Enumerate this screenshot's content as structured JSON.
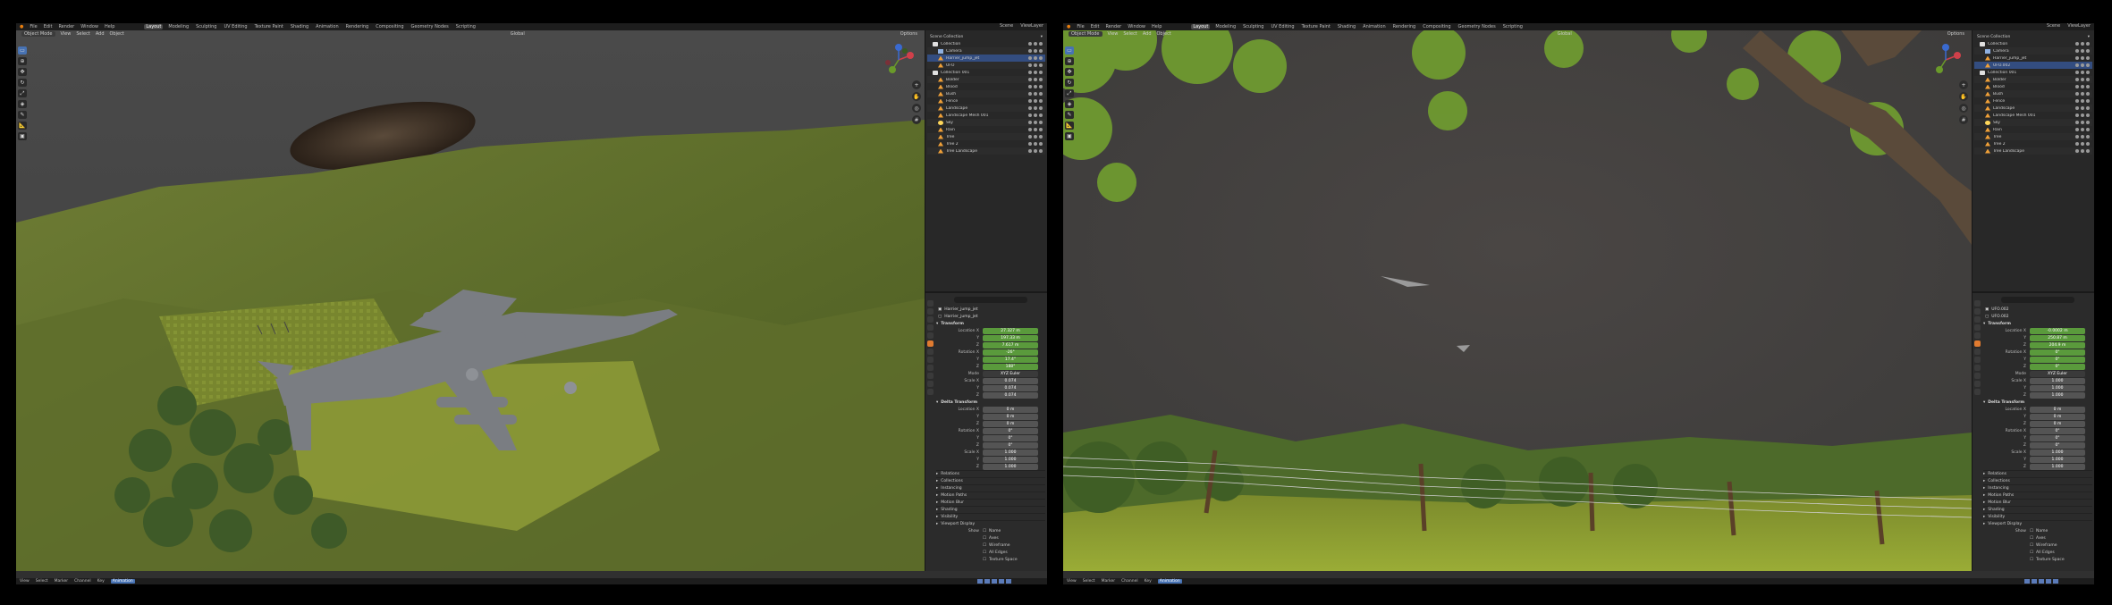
{
  "menu": {
    "items": [
      "File",
      "Edit",
      "Render",
      "Window",
      "Help"
    ],
    "workspaces": [
      "Layout",
      "Modeling",
      "Sculpting",
      "UV Editing",
      "Texture Paint",
      "Shading",
      "Animation",
      "Rendering",
      "Compositing",
      "Geometry Nodes",
      "Scripting"
    ],
    "active_workspace": "Layout",
    "scene_label": "Scene",
    "view_layer_label": "ViewLayer"
  },
  "left": {
    "viewport": {
      "mode": "Object Mode",
      "menus": [
        "View",
        "Select",
        "Add",
        "Object"
      ],
      "transform": "Global",
      "options": "Options"
    },
    "outliner": {
      "title": "Scene Collection",
      "rows": [
        {
          "name": "Collection",
          "kind": "coll",
          "indent": 1
        },
        {
          "name": "Camera",
          "kind": "cam",
          "indent": 2
        },
        {
          "name": "Harrier_jump_jet",
          "kind": "mesh",
          "indent": 2,
          "selected": true
        },
        {
          "name": "UFO",
          "kind": "mesh",
          "indent": 2
        },
        {
          "name": "Collection 001",
          "kind": "coll",
          "indent": 1
        },
        {
          "name": "Bolder",
          "kind": "mesh",
          "indent": 2
        },
        {
          "name": "Blood",
          "kind": "mesh",
          "indent": 2
        },
        {
          "name": "Bush",
          "kind": "mesh",
          "indent": 2
        },
        {
          "name": "Fence",
          "kind": "mesh",
          "indent": 2
        },
        {
          "name": "Landscape",
          "kind": "mesh",
          "indent": 2
        },
        {
          "name": "Landscape Mesh 001",
          "kind": "mesh",
          "indent": 2
        },
        {
          "name": "Sky",
          "kind": "light",
          "indent": 2
        },
        {
          "name": "Rain",
          "kind": "mesh",
          "indent": 2
        },
        {
          "name": "Tree",
          "kind": "mesh",
          "indent": 2
        },
        {
          "name": "Tree 2",
          "kind": "mesh",
          "indent": 2
        },
        {
          "name": "Tree Landscape",
          "kind": "mesh",
          "indent": 2
        }
      ]
    },
    "properties": {
      "object_name": "Harrier_jump_jet",
      "object_sub": "Harrier_jump_jet",
      "transform_header": "Transform",
      "location_label": "Location X",
      "location": [
        "27.327 m",
        "197.33 m",
        "7.617 m"
      ],
      "rotation_label": "Rotation X",
      "rotation": [
        "-26°",
        "17.4°",
        "188°"
      ],
      "mode_label": "Mode",
      "mode_value": "XYZ Euler",
      "scale_label": "Scale X",
      "scale": [
        "0.074",
        "0.074",
        "0.074"
      ],
      "delta_header": "Delta Transform",
      "delta_location_label": "Location X",
      "delta_location": [
        "0 m",
        "0 m",
        "0 m"
      ],
      "delta_rotation_label": "Rotation X",
      "delta_rotation": [
        "0°",
        "0°",
        "0°"
      ],
      "delta_scale_label": "Scale X",
      "delta_scale": [
        "1.000",
        "1.000",
        "1.000"
      ],
      "collapsed": [
        "Relations",
        "Collections",
        "Instancing",
        "Motion Paths",
        "Motion Blur",
        "Shading",
        "Visibility",
        "Viewport Display"
      ],
      "show_label": "Show",
      "show_opts": [
        "Name",
        "Axes",
        "Wireframe",
        "All Edges",
        "Texture Space"
      ]
    },
    "status": {
      "items": [
        "View",
        "Select",
        "Marker",
        "Channel",
        "Key"
      ],
      "active": "Animation"
    }
  },
  "right": {
    "viewport": {
      "mode": "Object Mode",
      "menus": [
        "View",
        "Select",
        "Add",
        "Object"
      ],
      "transform": "Global",
      "options": "Options"
    },
    "outliner": {
      "title": "Scene Collection",
      "rows": [
        {
          "name": "Collection",
          "kind": "coll",
          "indent": 1
        },
        {
          "name": "Camera",
          "kind": "cam",
          "indent": 2
        },
        {
          "name": "Harrier_jump_jet",
          "kind": "mesh",
          "indent": 2
        },
        {
          "name": "UFO.002",
          "kind": "mesh",
          "indent": 2,
          "selected": true
        },
        {
          "name": "Collection 001",
          "kind": "coll",
          "indent": 1
        },
        {
          "name": "Bolder",
          "kind": "mesh",
          "indent": 2
        },
        {
          "name": "Blood",
          "kind": "mesh",
          "indent": 2
        },
        {
          "name": "Bush",
          "kind": "mesh",
          "indent": 2
        },
        {
          "name": "Fence",
          "kind": "mesh",
          "indent": 2
        },
        {
          "name": "Landscape",
          "kind": "mesh",
          "indent": 2
        },
        {
          "name": "Landscape Mesh 001",
          "kind": "mesh",
          "indent": 2
        },
        {
          "name": "Sky",
          "kind": "light",
          "indent": 2
        },
        {
          "name": "Rain",
          "kind": "mesh",
          "indent": 2
        },
        {
          "name": "Tree",
          "kind": "mesh",
          "indent": 2
        },
        {
          "name": "Tree 2",
          "kind": "mesh",
          "indent": 2
        },
        {
          "name": "Tree Landscape",
          "kind": "mesh",
          "indent": 2
        }
      ]
    },
    "properties": {
      "object_name": "UFO.002",
      "object_sub": "UFO.002",
      "transform_header": "Transform",
      "location_label": "Location X",
      "location": [
        "-0.0002 m",
        "250.87 m",
        "204.9 m"
      ],
      "rotation_label": "Rotation X",
      "rotation": [
        "0°",
        "0°",
        "0°"
      ],
      "mode_label": "Mode",
      "mode_value": "XYZ Euler",
      "scale_label": "Scale X",
      "scale": [
        "1.000",
        "1.000",
        "1.000"
      ],
      "delta_header": "Delta Transform",
      "delta_location_label": "Location X",
      "delta_location": [
        "0 m",
        "0 m",
        "0 m"
      ],
      "delta_rotation_label": "Rotation X",
      "delta_rotation": [
        "0°",
        "0°",
        "0°"
      ],
      "delta_scale_label": "Scale X",
      "delta_scale": [
        "1.000",
        "1.000",
        "1.000"
      ],
      "collapsed": [
        "Relations",
        "Collections",
        "Instancing",
        "Motion Paths",
        "Motion Blur",
        "Shading",
        "Visibility",
        "Viewport Display"
      ],
      "show_label": "Show",
      "show_opts": [
        "Name",
        "Axes",
        "Wireframe",
        "All Edges",
        "Texture Space"
      ]
    },
    "status": {
      "items": [
        "View",
        "Select",
        "Marker",
        "Channel",
        "Key"
      ],
      "active": "Animation"
    }
  },
  "colors": {
    "accent": "#4772b3",
    "location_field": "#5a9a3c",
    "selected_row": "#334d80"
  }
}
